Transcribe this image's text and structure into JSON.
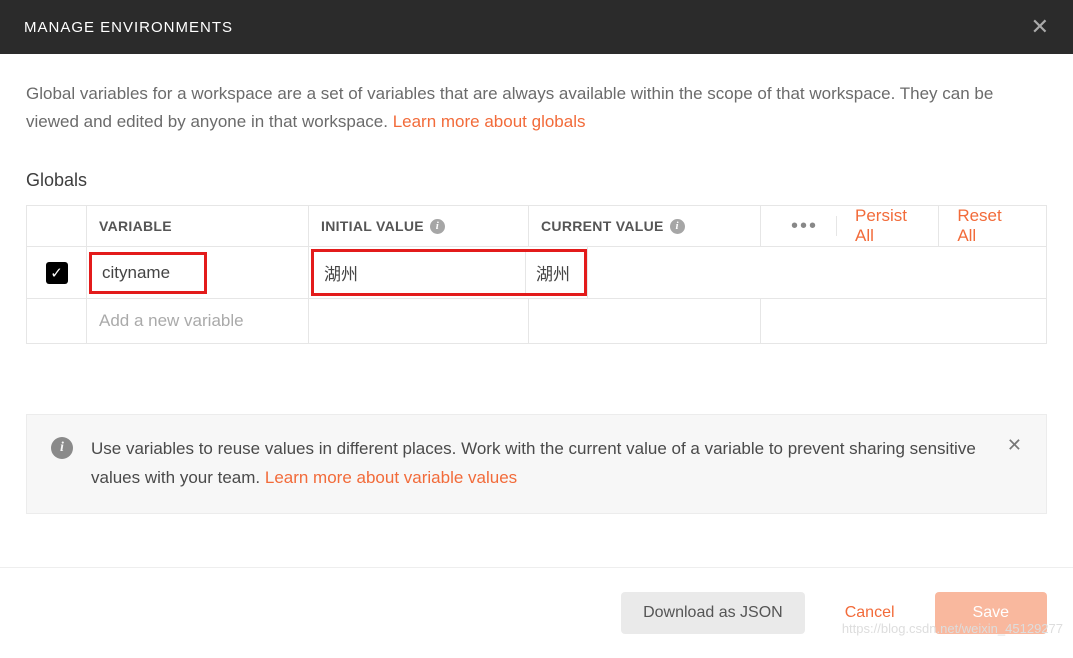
{
  "header": {
    "title": "MANAGE ENVIRONMENTS"
  },
  "intro": {
    "text_part1": "Global variables for a workspace are a set of variables that are always available within the scope of that workspace. They can be viewed and edited by anyone in that workspace. ",
    "link": "Learn more about globals"
  },
  "section": {
    "title": "Globals"
  },
  "table": {
    "headers": {
      "variable": "VARIABLE",
      "initial": "INITIAL VALUE",
      "current": "CURRENT VALUE"
    },
    "actions": {
      "persist_all": "Persist All",
      "reset_all": "Reset All"
    },
    "rows": [
      {
        "checked": true,
        "variable": "cityname",
        "initial": "湖州",
        "current": "湖州"
      }
    ],
    "placeholder": "Add a new variable"
  },
  "banner": {
    "text_part1": "Use variables to reuse values in different places. Work with the current value of a variable to prevent sharing sensitive values with your team. ",
    "link": "Learn more about variable values"
  },
  "footer": {
    "download": "Download as JSON",
    "cancel": "Cancel",
    "save": "Save"
  },
  "watermark": "https://blog.csdn.net/weixin_45129277"
}
